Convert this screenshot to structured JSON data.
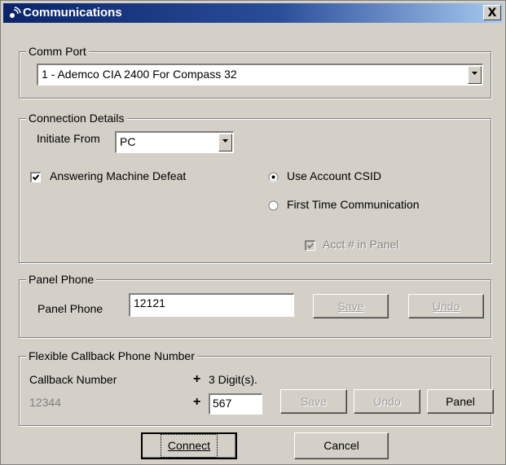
{
  "window": {
    "title": "Communications",
    "close_glyph": "X"
  },
  "comm_port": {
    "legend": "Comm Port",
    "selected": "1 - Ademco CIA 2400 For Compass 32"
  },
  "connection": {
    "legend": "Connection Details",
    "initiate_label": "Initiate From",
    "initiate_value": "PC",
    "answering_machine_label": "Answering Machine Defeat",
    "answering_machine_checked": true,
    "use_account_csid_label": "Use Account CSID",
    "use_account_csid_selected": true,
    "first_time_label": "First Time Communication",
    "acct_in_panel_label": "Acct # in Panel",
    "acct_in_panel_checked": true
  },
  "panel_phone": {
    "legend": "Panel Phone",
    "label": "Panel Phone",
    "value": "12121",
    "save_label": "Save",
    "undo_label": "Undo"
  },
  "callback": {
    "legend": "Flexible Callback Phone Number",
    "number_label": "Callback Number",
    "digits_label": "3 Digit(s).",
    "base_number": "12344",
    "plus_symbol": "+",
    "suffix_value": "567",
    "save_label": "Save",
    "undo_label": "Undo",
    "panel_label": "Panel"
  },
  "footer": {
    "connect_label": "Connect",
    "cancel_label": "Cancel"
  }
}
